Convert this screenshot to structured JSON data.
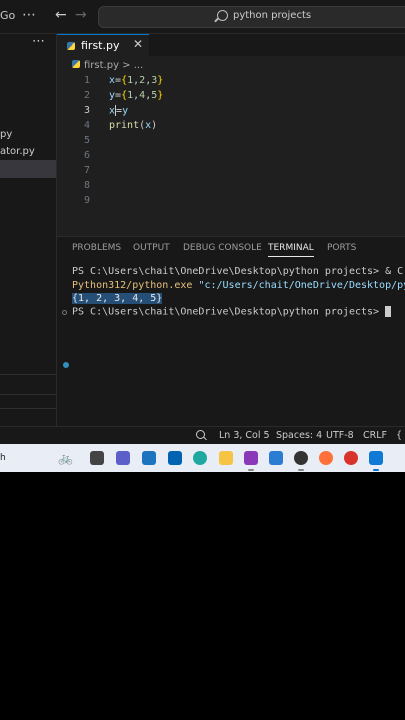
{
  "titlebar": {
    "menu_go": "Go",
    "search_text": "python projects"
  },
  "sidebar": {
    "files": [
      "py",
      "ator.py"
    ]
  },
  "editor": {
    "tab_label": "first.py",
    "breadcrumb": "first.py > ...",
    "line_numbers": [
      "1",
      "2",
      "3",
      "4",
      "5",
      "6",
      "7",
      "8",
      "9"
    ]
  },
  "panel": {
    "tabs": [
      "PROBLEMS",
      "OUTPUT",
      "DEBUG CONSOLE",
      "TERMINAL",
      "PORTS"
    ],
    "active_tab": "TERMINAL",
    "term_line1": "PS C:\\Users\\chait\\OneDrive\\Desktop\\python projects> & C:/Use",
    "term_line2_exe": "Python312/python.exe",
    "term_line2_path": " \"c:/Users/chait/OneDrive/Desktop/pytho",
    "term_output": "{1, 2, 3, 4, 5}",
    "term_prompt": "PS C:\\Users\\chait\\OneDrive\\Desktop\\python projects> "
  },
  "statusbar": {
    "position": "Ln 3, Col 5",
    "spaces": "Spaces: 4",
    "encoding": "UTF-8",
    "eol": "CRLF",
    "lang_partial": "{"
  },
  "taskbar": {
    "left_text": "h"
  },
  "colors": {
    "accent": "#0078d4",
    "terminal_selection": "#264f78"
  }
}
